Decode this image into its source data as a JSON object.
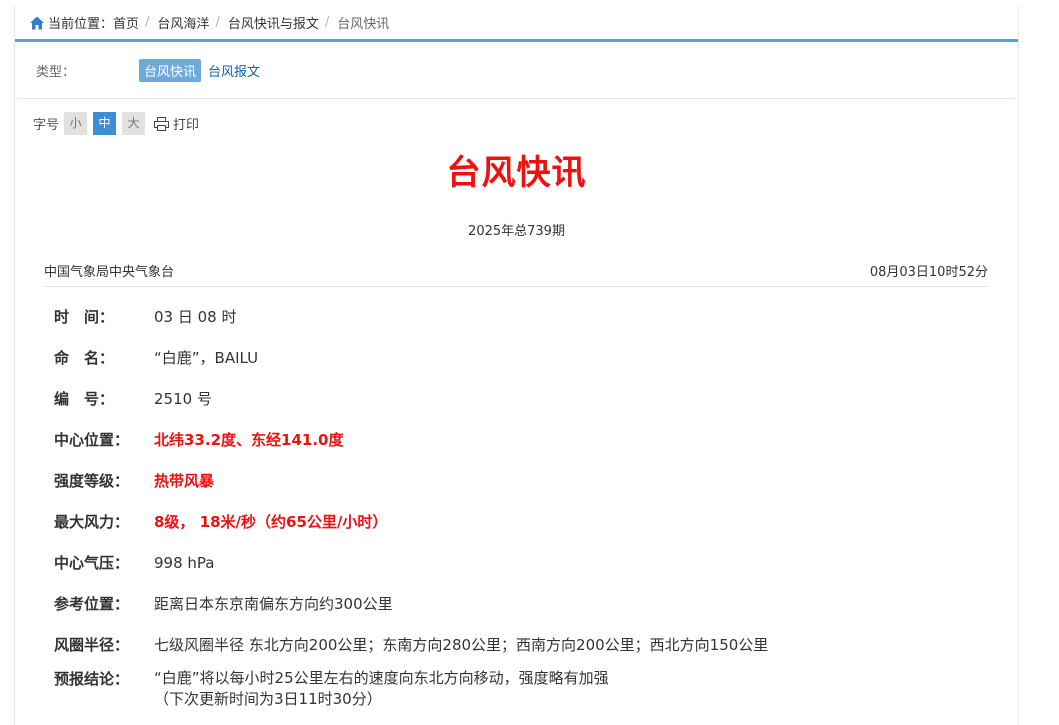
{
  "breadcrumb": {
    "prefix": "当前位置：",
    "items": [
      "首页",
      "台风海洋",
      "台风快讯与报文",
      "台风快讯"
    ],
    "separator": "/"
  },
  "type_filter": {
    "label": "类型：",
    "tags": [
      {
        "label": "台风快讯",
        "active": true
      },
      {
        "label": "台风报文",
        "active": false
      }
    ]
  },
  "font_size": {
    "label": "字号",
    "options": [
      "小",
      "中",
      "大"
    ],
    "selected": "中",
    "print_label": "打印"
  },
  "article": {
    "title": "台风快讯",
    "issue": "2025年总739期",
    "source": "中国气象局中央气象台",
    "publish_time": "08月03日10时52分",
    "fields": [
      {
        "key": "时　间：",
        "value": "03 日 08 时",
        "highlight": false
      },
      {
        "key": "命　名：",
        "value": "“白鹿”，BAILU",
        "highlight": false
      },
      {
        "key": "编　号：",
        "value": "2510 号",
        "highlight": false
      },
      {
        "key": "中心位置：",
        "value": "北纬33.2度、东经141.0度",
        "highlight": true
      },
      {
        "key": "强度等级：",
        "value": "热带风暴",
        "highlight": true
      },
      {
        "key": "最大风力：",
        "value": "8级， 18米/秒（约65公里/小时）",
        "highlight": true
      },
      {
        "key": "中心气压：",
        "value": "998 hPa",
        "highlight": false
      },
      {
        "key": "参考位置：",
        "value": "距离日本东京南偏东方向约300公里",
        "highlight": false
      },
      {
        "key": "风圈半径：",
        "value": "七级风圈半径 东北方向200公里；东南方向280公里；西南方向200公里；西北方向150公里",
        "highlight": false
      }
    ],
    "forecast": {
      "key": "预报结论：",
      "line1": "“白鹿”将以每小时25公里左右的速度向东北方向移动，强度略有加强",
      "line2": "（下次更新时间为3日11时30分）"
    }
  },
  "colors": {
    "accent_blue": "#5aa0e6",
    "title_red": "#ee1111",
    "active_tag": "#6fa8dc",
    "active_font_btn": "#3a8fd6"
  }
}
